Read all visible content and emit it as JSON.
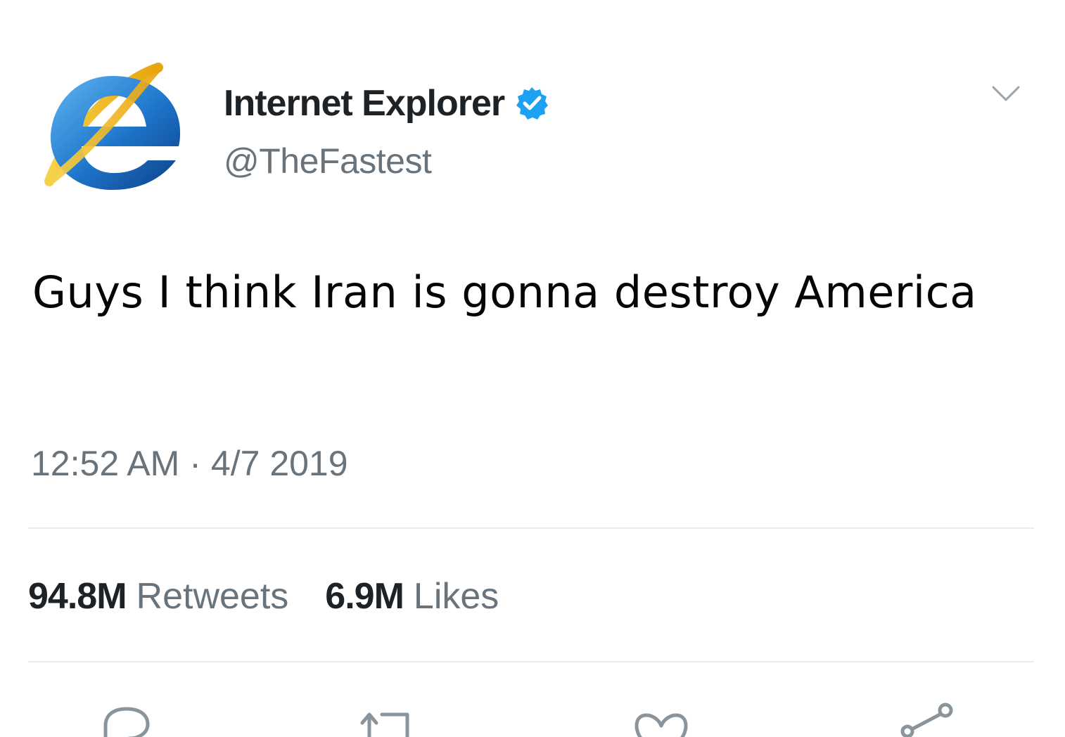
{
  "account": {
    "display_name": "Internet Explorer",
    "handle": "@TheFastest",
    "verified": true,
    "avatar_icon": "internet-explorer-logo"
  },
  "tweet": {
    "text": "Guys I think Iran is gonna destroy America",
    "time": "12:52 AM",
    "separator": "·",
    "date": "4/7 2019"
  },
  "stats": {
    "retweets_count": "94.8M",
    "retweets_label": "Retweets",
    "likes_count": "6.9M",
    "likes_label": "Likes"
  },
  "actions": [
    {
      "icon": "reply-icon"
    },
    {
      "icon": "retweet-icon"
    },
    {
      "icon": "like-icon"
    },
    {
      "icon": "share-icon"
    }
  ],
  "colors": {
    "verified_badge": "#1da1f2",
    "secondary_text": "#68737c",
    "primary_text": "#1c2226",
    "divider": "#e8ecef"
  }
}
